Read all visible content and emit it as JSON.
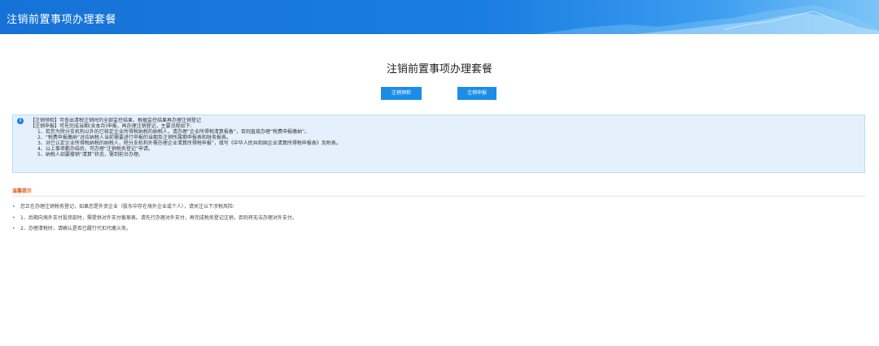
{
  "header": {
    "title": "注销前置事项办理套餐"
  },
  "main": {
    "title": "注销前置事项办理套餐",
    "buttons": [
      {
        "label": "注销预检"
      },
      {
        "label": "注销申报"
      }
    ]
  },
  "info": {
    "icon": "info-circle-icon",
    "lines": [
      "【注销预检】可查出清税注销时的全部监控结果，根据监控结果再办理注销登记",
      "【注销申报】可先完成当期(含本月)申报，再办理注销登记，主要流程如下:",
      "1、若您为除分支机构以外的已核定企业所得税纳税的纳税人，请办理“企业所得税清算报备”，否则直接办理“税费申报缴纳”。",
      "2、“税费申报缴纳”对应纳税人当前需要进行申报的当期及注销所属期申报表和财务报表。",
      "3、对已认定企业所得税纳税的纳税人，除分支机构外需办理企业清算所得税申报”，填写《中华人民共和国企业清算所得税申报表》及附表。",
      "4、以上事项都办结后，可办理“注销税务登记”申请。",
      "5、纳税人如要撤销“清算”状态，需到前台办理。"
    ]
  },
  "warning": {
    "title": "温馨提示",
    "items": [
      "您正在办理注销税务登记，如果您是外资企业（股东中存在境外企业或个人），请关注以下涉税风险:",
      "1、后期向境外支付投资款时，需提供对外支付备案表。请先行办理对外支付，再完成税务登记注销，否则将无法办理对外支付。",
      "2、办理清税时，请确认是否已履行代扣代缴义务。"
    ]
  },
  "colors": {
    "header": "#1a7de0",
    "button": "#1c8de6",
    "info_bg": "#e4f1fd",
    "warn_title": "#e0601c"
  }
}
